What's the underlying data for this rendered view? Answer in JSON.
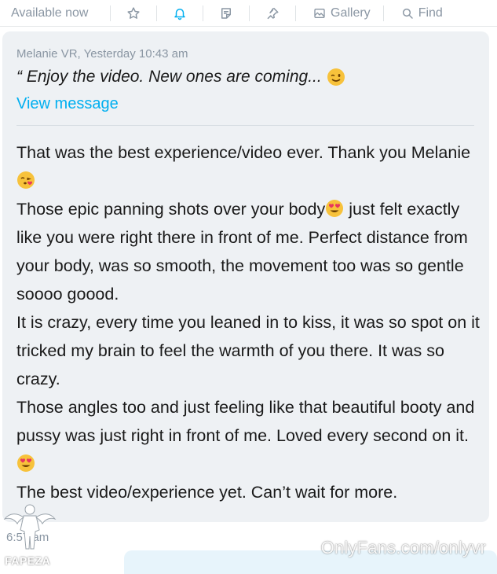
{
  "toolbar": {
    "status_label": "Available now",
    "gallery_label": "Gallery",
    "find_label": "Find",
    "active_color": "#00aff0",
    "icons": [
      "star-icon",
      "bell-icon",
      "note-icon",
      "pin-icon",
      "gallery-icon",
      "search-icon"
    ]
  },
  "message": {
    "quote": {
      "meta": "Melanie VR, Yesterday 10:43 am",
      "text": "“ Enjoy the video. New ones are coming...",
      "view_link": "View message"
    },
    "paragraphs": [
      {
        "text": "That was the best experience/video ever. Thank you Melanie",
        "emoji": "kissing-heart-emoji"
      },
      {
        "text_before": "Those epic panning shots over your body",
        "emoji": "heart-eyes-emoji",
        "text_after": " just felt exactly like you were right there in front of me. Perfect distance from your body, was so smooth, the movement too was so gentle soooo goood."
      },
      {
        "text": "It is crazy, every time you leaned in to kiss, it was so spot on it tricked my brain to feel the warmth of you there. It was so crazy."
      },
      {
        "text": "Those angles too and just feeling like that beautiful booty and pussy was just right in front of me. Loved every second on it.",
        "emoji": "heart-eyes-emoji"
      },
      {
        "text": "The best video/experience yet. Can’t wait for more."
      }
    ],
    "timestamp": "6:57 am"
  },
  "watermark": {
    "text": "OnlyFans.com/onlyvr",
    "logo_text": "FAPEZA"
  }
}
